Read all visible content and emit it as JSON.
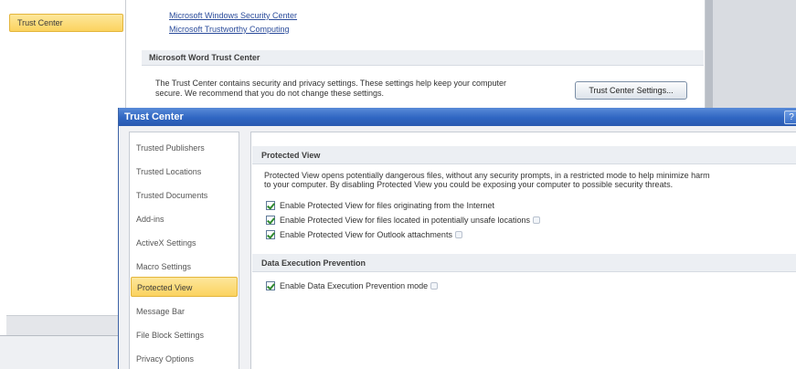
{
  "background": {
    "sidebar_selected": "Trust Center",
    "links": [
      "Microsoft Windows Security Center",
      "Microsoft Trustworthy Computing"
    ],
    "section_title": "Microsoft Word Trust Center",
    "description_line1": "The Trust Center contains security and privacy settings. These settings help keep your computer",
    "description_line2": "secure. We recommend that you do not change these settings.",
    "trust_center_button": "Trust Center Settings..."
  },
  "dialog": {
    "title": "Trust Center",
    "help_glyph": "?",
    "nav": {
      "items": [
        "Trusted Publishers",
        "Trusted Locations",
        "Trusted Documents",
        "Add-ins",
        "ActiveX Settings",
        "Macro Settings",
        "Protected View",
        "Message Bar",
        "File Block Settings",
        "Privacy Options"
      ],
      "selected_index": 6
    },
    "protected_view": {
      "heading": "Protected View",
      "description_line1": "Protected View opens potentially dangerous files, without any security prompts, in a restricted mode to help minimize harm",
      "description_line2": "to your computer. By disabling Protected View you could be exposing your computer to possible security threats.",
      "options": [
        {
          "label": "Enable Protected View for files originating from the Internet",
          "checked": true
        },
        {
          "label": "Enable Protected View for files located in potentially unsafe locations",
          "checked": true
        },
        {
          "label": "Enable Protected View for Outlook attachments",
          "checked": true
        }
      ]
    },
    "dep": {
      "heading": "Data Execution Prevention",
      "option_label": "Enable Data Execution Prevention mode",
      "checked": true
    }
  },
  "colors": {
    "titlebar": "#2f66c2",
    "selection": "#fbd35f",
    "link": "#2b4c9b",
    "checkmark": "#2f8a2f"
  },
  "icons": [
    "checkbox-checked-icon",
    "info-icon",
    "help-icon"
  ]
}
